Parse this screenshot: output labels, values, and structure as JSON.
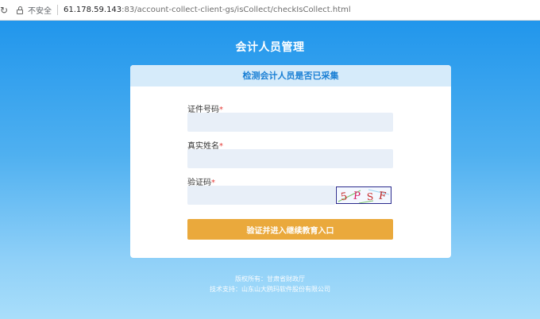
{
  "browser": {
    "security_label": "不安全",
    "url_host": "61.178.59.143",
    "url_path": ":83/account-collect-client-gs/isCollect/checkIsCollect.html"
  },
  "page": {
    "title": "会计人员管理"
  },
  "card": {
    "header": "检测会计人员是否已采集",
    "fields": [
      {
        "label": "证件号码",
        "required_mark": "*",
        "value": "",
        "placeholder": ""
      },
      {
        "label": "真实姓名",
        "required_mark": "*",
        "value": "",
        "placeholder": ""
      },
      {
        "label": "验证码",
        "required_mark": "*",
        "value": "",
        "placeholder": ""
      }
    ],
    "captcha_text": "5PSF",
    "submit_label": "验证并进入继续教育入口"
  },
  "footer": {
    "copyright": "版权所有：甘肃省财政厅",
    "support": "技术支持：山东山大鸥玛软件股份有限公司"
  },
  "colors": {
    "accent": "#1a7fd4",
    "button": "#eaa93c",
    "required": "#e53935"
  }
}
